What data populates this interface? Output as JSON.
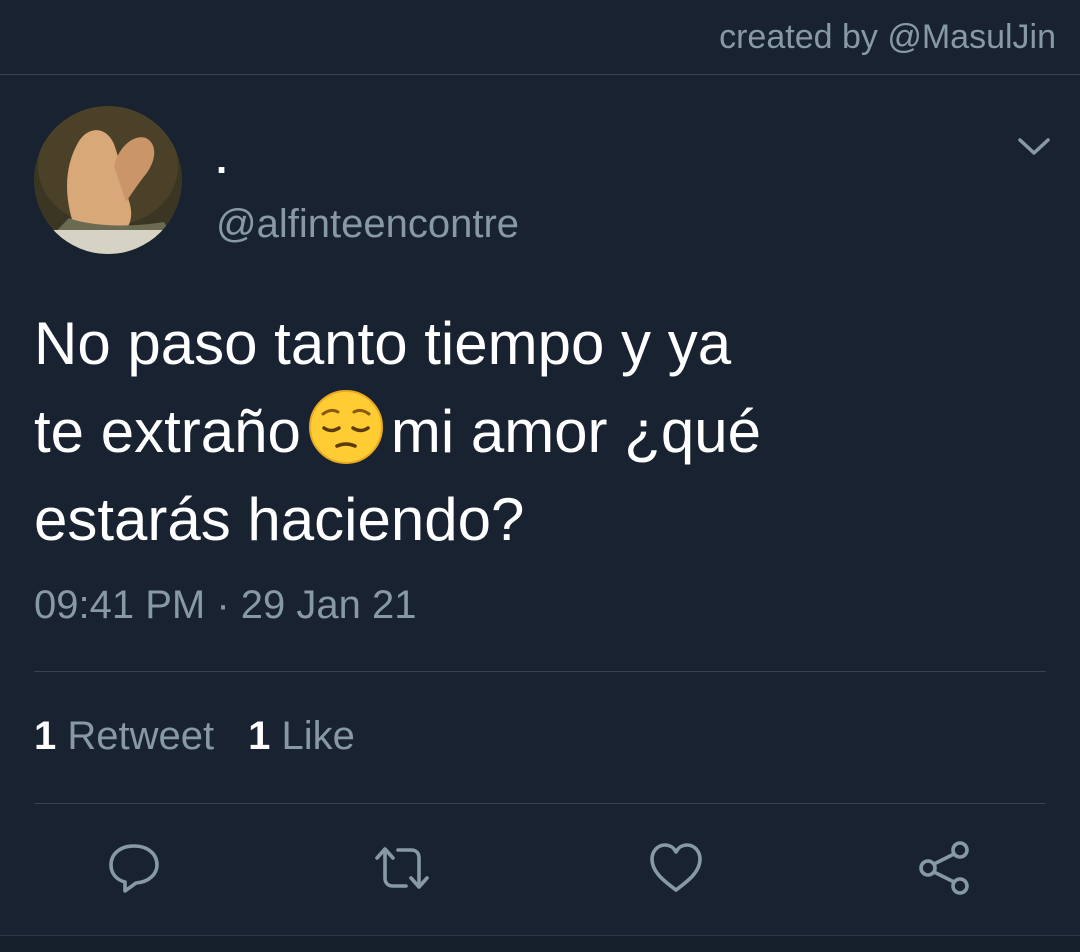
{
  "credit": "created by @MasulJin",
  "tweet": {
    "display_name": ".",
    "handle": "@alfinteencontre",
    "text_line1": "No paso tanto tiempo y ya",
    "text_line2_before": "te extraño",
    "text_line2_after": "mi amor ¿qué",
    "text_line3": "estarás haciendo?",
    "emoji_icon": "pensive-face-icon",
    "timestamp": "09:41 PM · 29 Jan 21",
    "retweet_count": "1",
    "retweet_label": "Retweet",
    "like_count": "1",
    "like_label": "Like"
  },
  "colors": {
    "background": "#182230",
    "secondary_text": "#8899a6",
    "divider": "#38444d"
  },
  "actions": [
    {
      "name": "reply-icon"
    },
    {
      "name": "retweet-icon"
    },
    {
      "name": "like-icon"
    },
    {
      "name": "share-icon"
    }
  ]
}
